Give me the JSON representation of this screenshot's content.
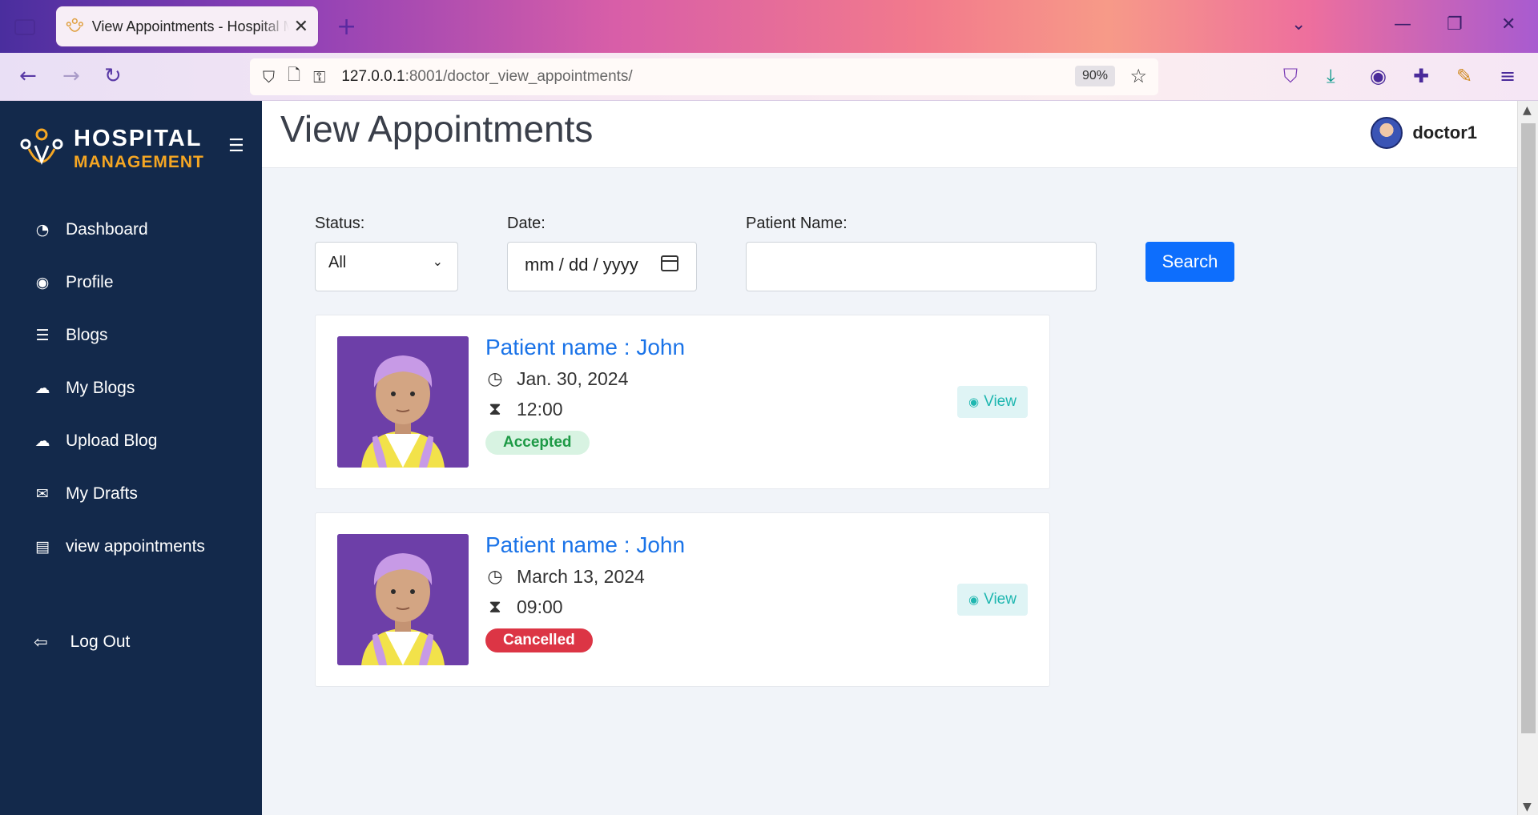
{
  "browser": {
    "tab_title": "View Appointments - Hospital Management",
    "new_tab": "+",
    "tab_close": "✕",
    "url_host": "127.0.0.1",
    "url_rest": ":8001/doctor_view_appointments/",
    "zoom": "90%"
  },
  "sidebar": {
    "brand_line1": "HOSPITAL",
    "brand_line2": "MANAGEMENT",
    "items": [
      {
        "label": "Dashboard",
        "icon": "gauge-icon"
      },
      {
        "label": "Profile",
        "icon": "user-circle-icon"
      },
      {
        "label": "Blogs",
        "icon": "list-icon"
      },
      {
        "label": "My Blogs",
        "icon": "cloud-icon"
      },
      {
        "label": "Upload Blog",
        "icon": "cloud-upload-icon"
      },
      {
        "label": "My Drafts",
        "icon": "envelope-open-icon"
      },
      {
        "label": "view appointments",
        "icon": "id-card-icon"
      }
    ],
    "logout": "Log Out"
  },
  "header": {
    "title": "View Appointments",
    "username": "doctor1"
  },
  "filters": {
    "status_label": "Status:",
    "status_value": "All",
    "date_label": "Date:",
    "date_placeholder": "mm / dd / yyyy",
    "patient_label": "Patient Name:",
    "patient_value": "",
    "search_label": "Search"
  },
  "appointments": [
    {
      "name": "Patient name  : John",
      "date": "Jan. 30, 2024",
      "time": "12:00",
      "status": "Accepted",
      "view": "View"
    },
    {
      "name": "Patient name  : John",
      "date": "March 13, 2024",
      "time": "09:00",
      "status": "Cancelled",
      "view": "View"
    }
  ],
  "colors": {
    "sidebar_bg": "#13294b",
    "brand_accent": "#f5a623",
    "primary": "#0d6efd",
    "accepted": "#1e9a46",
    "cancelled": "#dc3545",
    "view_text": "#1fb7b0"
  }
}
